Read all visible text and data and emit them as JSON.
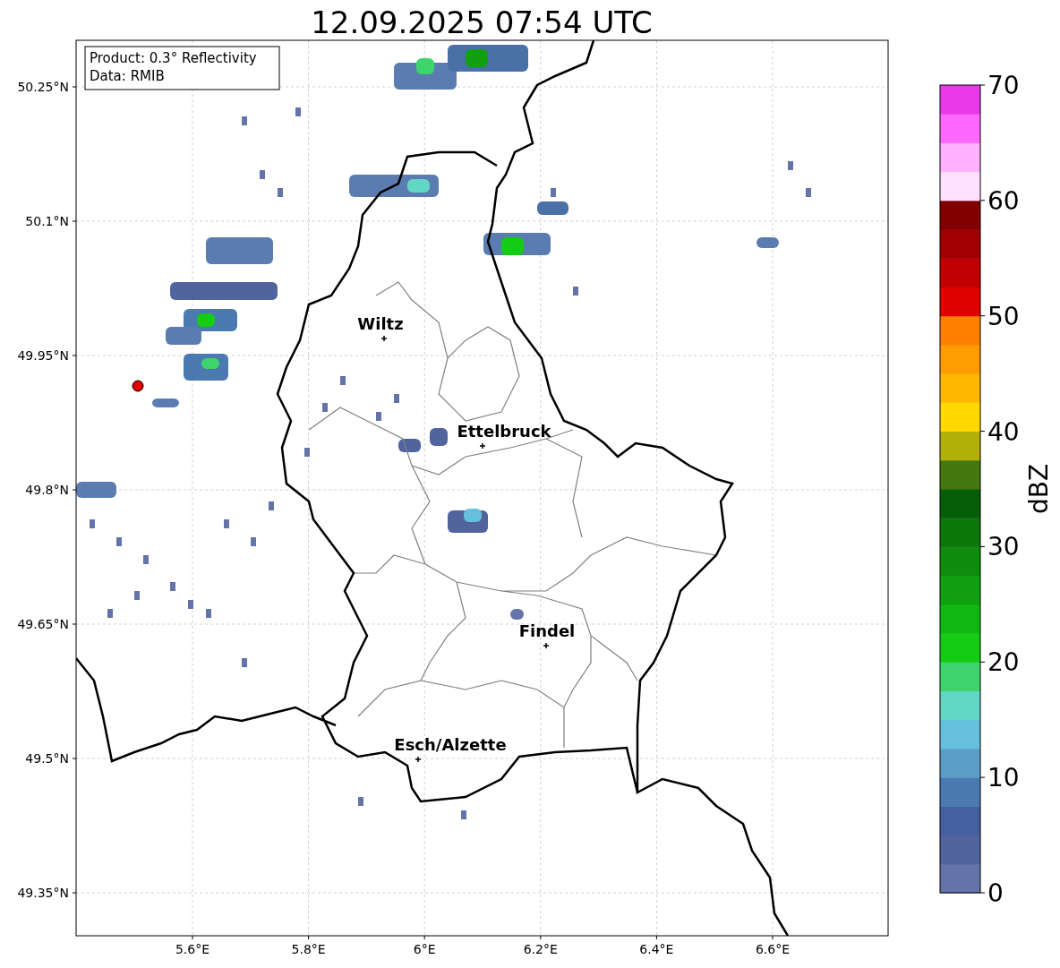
{
  "title": "12.09.2025 07:54 UTC",
  "info_box": [
    "Product: 0.3° Reflectivity",
    "Data: RMIB"
  ],
  "y_ticks": [
    "50.25°N",
    "50.1°N",
    "49.95°N",
    "49.8°N",
    "49.65°N",
    "49.5°N",
    "49.35°N"
  ],
  "x_ticks": [
    "5.6°E",
    "5.8°E",
    "6°E",
    "6.2°E",
    "6.4°E",
    "6.6°E"
  ],
  "cities": [
    {
      "name": "Wiltz"
    },
    {
      "name": "Ettelbruck"
    },
    {
      "name": "Findel"
    },
    {
      "name": "Esch/Alzette"
    }
  ],
  "colorbar": {
    "label": "dBZ",
    "ticks": [
      "70",
      "60",
      "50",
      "40",
      "30",
      "20",
      "10",
      "0"
    ],
    "bands": [
      {
        "color": "#6474a8"
      },
      {
        "color": "#52649e"
      },
      {
        "color": "#4460a0"
      },
      {
        "color": "#4a7ab0"
      },
      {
        "color": "#5a9ec8"
      },
      {
        "color": "#64c0dc"
      },
      {
        "color": "#62d8c4"
      },
      {
        "color": "#3ed46c"
      },
      {
        "color": "#14cc14"
      },
      {
        "color": "#12b812"
      },
      {
        "color": "#10a010"
      },
      {
        "color": "#0e8c0e"
      },
      {
        "color": "#0c780c"
      },
      {
        "color": "#085e08"
      },
      {
        "color": "#467810"
      },
      {
        "color": "#b0b008"
      },
      {
        "color": "#ffd800"
      },
      {
        "color": "#ffb800"
      },
      {
        "color": "#ff9c00"
      },
      {
        "color": "#ff8000"
      },
      {
        "color": "#e00000"
      },
      {
        "color": "#c00000"
      },
      {
        "color": "#a00000"
      },
      {
        "color": "#800000"
      },
      {
        "color": "#ffe0ff"
      },
      {
        "color": "#ffb0ff"
      },
      {
        "color": "#ff68ff"
      },
      {
        "color": "#e838e8"
      }
    ]
  }
}
